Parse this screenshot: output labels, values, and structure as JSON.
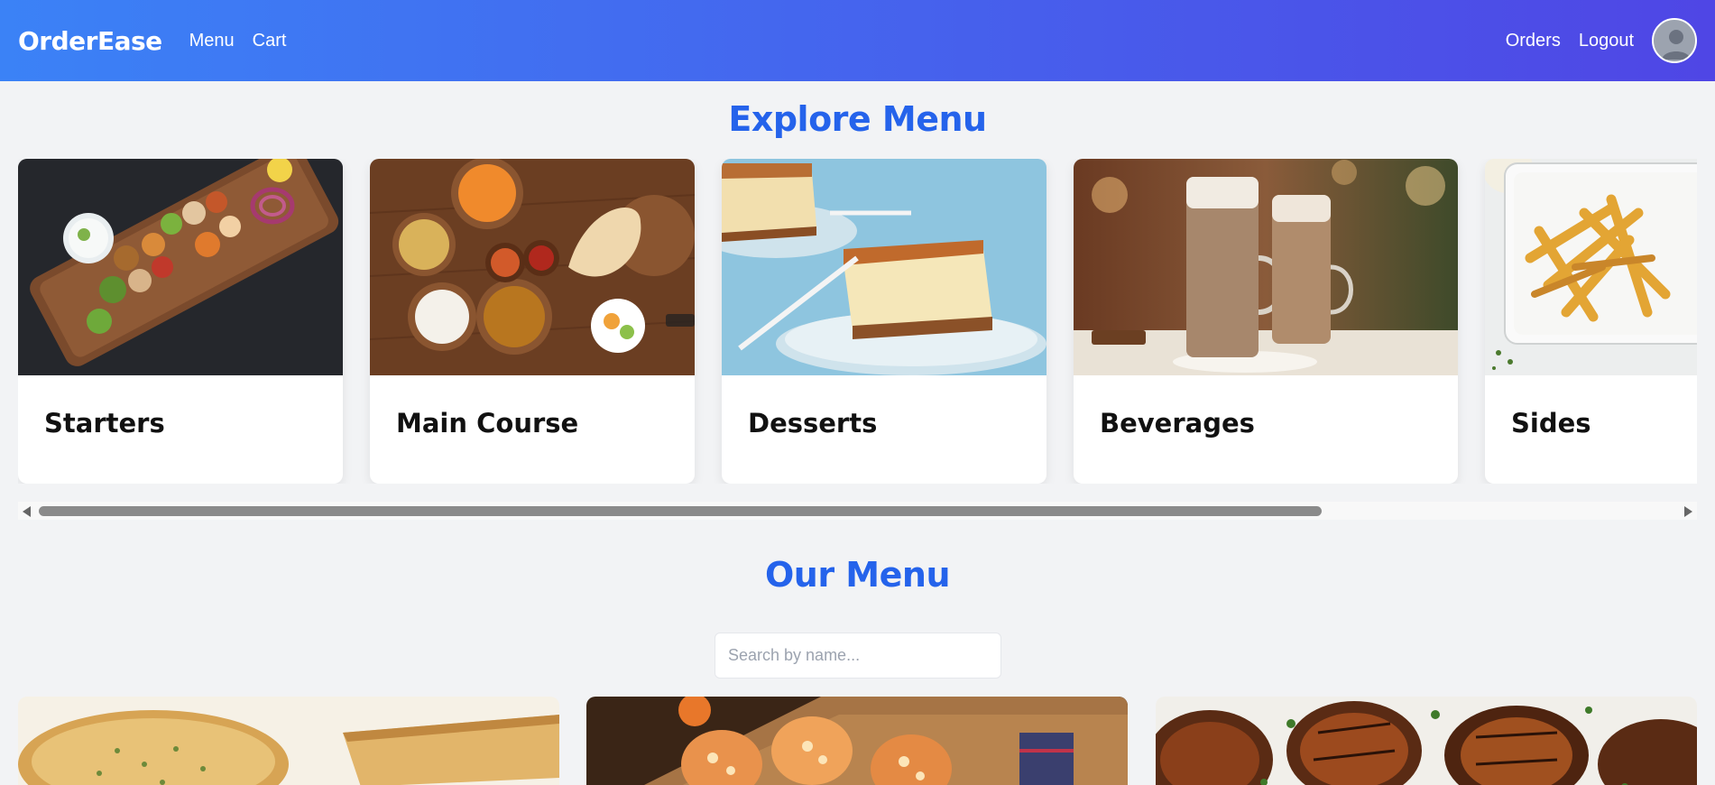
{
  "nav": {
    "brand": "OrderEase",
    "links_left": [
      "Menu",
      "Cart"
    ],
    "links_right": [
      "Orders",
      "Logout"
    ],
    "avatar_icon": "user-avatar-icon"
  },
  "explore": {
    "title": "Explore Menu",
    "categories": [
      {
        "name": "Starters",
        "image": "grilled kebab skewers"
      },
      {
        "name": "Main Course",
        "image": "indian curry thali spread"
      },
      {
        "name": "Desserts",
        "image": "biscoff cheesecake"
      },
      {
        "name": "Beverages",
        "image": "lattes in glass mugs"
      },
      {
        "name": "Sides",
        "image": "seasoned french fries"
      }
    ]
  },
  "our_menu": {
    "title": "Our Menu",
    "search_placeholder": "Search by name...",
    "items": [
      {
        "image": "garlic bread"
      },
      {
        "image": "stuffed bell peppers / cheesy bites"
      },
      {
        "image": "grilled chicken"
      }
    ]
  },
  "colors": {
    "nav_gradient_start": "#3b82f6",
    "nav_gradient_end": "#4f46e5",
    "title_blue": "#2563eb",
    "page_bg": "#f2f3f5"
  }
}
